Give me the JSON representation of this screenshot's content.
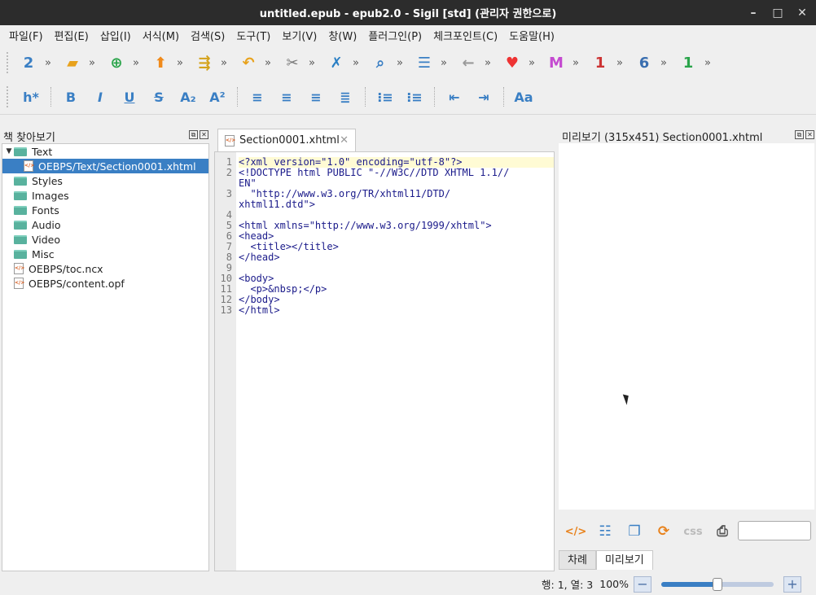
{
  "window": {
    "title": "untitled.epub - epub2.0 - Sigil [std] (관리자 권한으로)",
    "controls": [
      "–",
      "□",
      "✕"
    ]
  },
  "menu": [
    "파일(F)",
    "편집(E)",
    "삽입(I)",
    "서식(M)",
    "검색(S)",
    "도구(T)",
    "보기(V)",
    "창(W)",
    "플러그인(P)",
    "체크포인트(C)",
    "도움말(H)"
  ],
  "toolbar1": {
    "chevron": "»",
    "buttons": [
      {
        "name": "new-file-icon",
        "glyph": "2",
        "color": "#3a7fc4"
      },
      {
        "name": "open-folder-icon",
        "glyph": "▰",
        "color": "#e8a21c"
      },
      {
        "name": "add-file-icon",
        "glyph": "⊕",
        "color": "#2aa44a"
      },
      {
        "name": "upload-icon",
        "glyph": "⬆",
        "color": "#f08a1a"
      },
      {
        "name": "reorder-icon",
        "glyph": "⇶",
        "color": "#d4a21a"
      },
      {
        "name": "undo-icon",
        "glyph": "↶",
        "color": "#e8a21c"
      },
      {
        "name": "scissors-icon",
        "glyph": "✂",
        "color": "#777"
      },
      {
        "name": "clean-icon",
        "glyph": "✗",
        "color": "#2a7fc4"
      },
      {
        "name": "search-icon",
        "glyph": "⌕",
        "color": "#3a7fc4"
      },
      {
        "name": "split-icon",
        "glyph": "☰",
        "color": "#3a7fc4"
      },
      {
        "name": "back-arrow-icon",
        "glyph": "←",
        "color": "#999"
      },
      {
        "name": "heart-icon",
        "glyph": "♥",
        "color": "#e33"
      },
      {
        "name": "m-icon",
        "glyph": "M",
        "color": "#c44ad0"
      },
      {
        "name": "plugin-red-icon",
        "glyph": "1",
        "color": "#c33"
      },
      {
        "name": "plugin-blue-icon",
        "glyph": "6",
        "color": "#3a6fb0"
      },
      {
        "name": "plugin-green-icon",
        "glyph": "1",
        "color": "#2aa44a"
      }
    ]
  },
  "toolbar2": {
    "buttons": [
      {
        "name": "heading-icon",
        "glyph": "h*",
        "color": "#3a7fc4"
      },
      {
        "name": "bold-icon",
        "glyph": "B",
        "color": "#3a7fc4"
      },
      {
        "name": "italic-icon",
        "glyph": "I",
        "color": "#3a7fc4"
      },
      {
        "name": "underline-icon",
        "glyph": "U",
        "color": "#3a7fc4"
      },
      {
        "name": "strikethrough-icon",
        "glyph": "S",
        "color": "#3a7fc4"
      },
      {
        "name": "subscript-icon",
        "glyph": "A₂",
        "color": "#3a7fc4"
      },
      {
        "name": "superscript-icon",
        "glyph": "A²",
        "color": "#3a7fc4"
      },
      {
        "name": "align-left-icon",
        "glyph": "≡",
        "color": "#3a7fc4"
      },
      {
        "name": "align-center-icon",
        "glyph": "≡",
        "color": "#3a7fc4"
      },
      {
        "name": "align-right-icon",
        "glyph": "≡",
        "color": "#3a7fc4"
      },
      {
        "name": "justify-icon",
        "glyph": "≣",
        "color": "#3a7fc4"
      },
      {
        "name": "bullet-list-icon",
        "glyph": "⁝≡",
        "color": "#3a7fc4"
      },
      {
        "name": "numbered-list-icon",
        "glyph": "⁝≡",
        "color": "#3a7fc4"
      },
      {
        "name": "outdent-icon",
        "glyph": "⇤",
        "color": "#3a7fc4"
      },
      {
        "name": "indent-icon",
        "glyph": "⇥",
        "color": "#3a7fc4"
      },
      {
        "name": "case-icon",
        "glyph": "Aa",
        "color": "#3a7fc4"
      }
    ]
  },
  "book_browser": {
    "title": "책 찾아보기",
    "items": [
      {
        "label": "Text",
        "kind": "folder",
        "indent": 0,
        "expanded": true
      },
      {
        "label": "OEBPS/Text/Section0001.xhtml",
        "kind": "file",
        "indent": 1,
        "selected": true
      },
      {
        "label": "Styles",
        "kind": "folder",
        "indent": 0
      },
      {
        "label": "Images",
        "kind": "folder",
        "indent": 0
      },
      {
        "label": "Fonts",
        "kind": "folder",
        "indent": 0
      },
      {
        "label": "Audio",
        "kind": "folder",
        "indent": 0
      },
      {
        "label": "Video",
        "kind": "folder",
        "indent": 0
      },
      {
        "label": "Misc",
        "kind": "folder",
        "indent": 0
      },
      {
        "label": "OEBPS/toc.ncx",
        "kind": "file",
        "indent": 0
      },
      {
        "label": "OEBPS/content.opf",
        "kind": "file",
        "indent": 0
      }
    ]
  },
  "editor": {
    "tab_label": "Section0001.xhtml",
    "lines": [
      "<?xml version=\"1.0\" encoding=\"utf-8\"?>",
      "<!DOCTYPE html PUBLIC \"-//W3C//DTD XHTML 1.1//",
      "EN\"",
      "  \"http://www.w3.org/TR/xhtml11/DTD/",
      "xhtml11.dtd\">",
      "",
      "<html xmlns=\"http://www.w3.org/1999/xhtml\">",
      "<head>",
      "  <title></title>",
      "</head>",
      "",
      "<body>",
      "  <p>&nbsp;</p>",
      "</body>",
      "</html>"
    ],
    "line_numbers": [
      "1",
      "2",
      "",
      "3",
      "",
      "4",
      "5",
      "6",
      "7",
      "8",
      "9",
      "10",
      "11",
      "12",
      "13"
    ]
  },
  "preview": {
    "title": "미리보기 (315x451) Section0001.xhtml",
    "tools": [
      {
        "name": "code-view-icon",
        "glyph": "</>",
        "color": "#e8821c"
      },
      {
        "name": "inspect-icon",
        "glyph": "☷",
        "color": "#3a7fc4"
      },
      {
        "name": "copy-icon",
        "glyph": "❐",
        "color": "#3a7fc4"
      },
      {
        "name": "refresh-icon",
        "glyph": "⟳",
        "color": "#e8821c"
      },
      {
        "name": "css-icon",
        "glyph": "css",
        "color": "#bbb"
      },
      {
        "name": "printer-icon",
        "glyph": "⎙",
        "color": "#555"
      }
    ],
    "bottom_tabs": [
      "차례",
      "미리보기"
    ],
    "active_tab": 1
  },
  "status": {
    "position": "행: 1, 열: 3",
    "zoom": "100%",
    "zoom_fraction": 0.5
  }
}
